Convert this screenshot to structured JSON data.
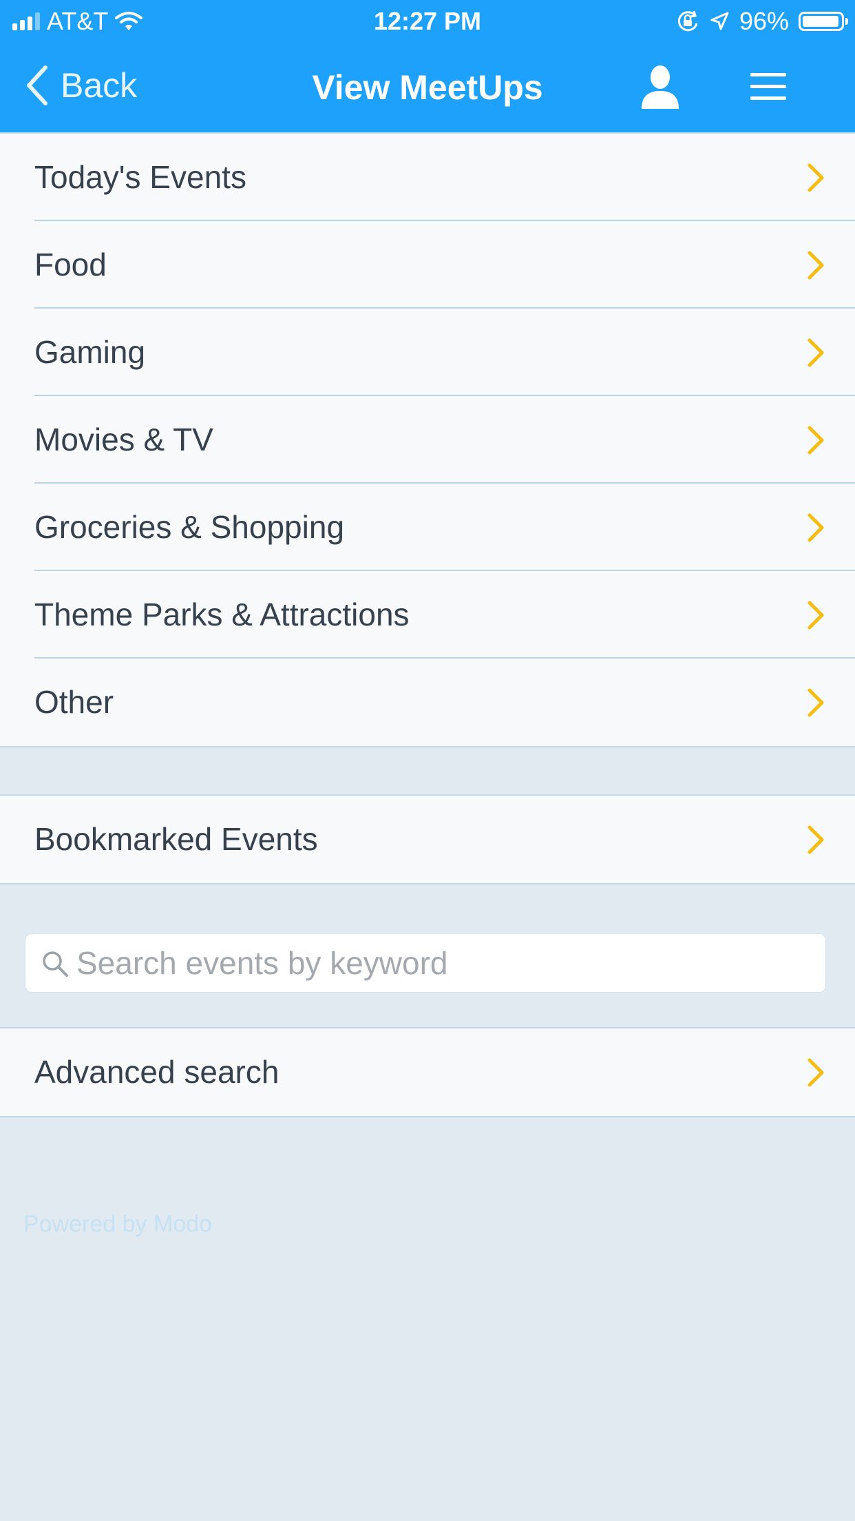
{
  "status_bar": {
    "carrier": "AT&T",
    "time": "12:27 PM",
    "battery_percent": "96%",
    "battery_level": 0.96,
    "icons": [
      "signal-icon",
      "wifi-icon",
      "orientation-lock-icon",
      "location-icon",
      "battery-icon"
    ]
  },
  "nav": {
    "back_label": "Back",
    "title": "View MeetUps",
    "profile_icon": "person-icon",
    "menu_icon": "hamburger-menu-icon"
  },
  "categories": [
    {
      "label": "Today's Events"
    },
    {
      "label": "Food"
    },
    {
      "label": "Gaming"
    },
    {
      "label": "Movies & TV"
    },
    {
      "label": "Groceries & Shopping"
    },
    {
      "label": "Theme Parks & Attractions"
    },
    {
      "label": "Other"
    }
  ],
  "bookmarks": {
    "label": "Bookmarked Events"
  },
  "search": {
    "placeholder": "Search events by keyword",
    "value": ""
  },
  "advanced_search": {
    "label": "Advanced search"
  },
  "footer": {
    "powered_by": "Powered by Modo"
  },
  "colors": {
    "header_bg": "#1ea1fb",
    "page_bg": "#e1eaf0",
    "row_bg": "#f7f9fb",
    "chevron": "#f5bd12",
    "row_text": "#36414d",
    "footer_text": "#c6e0f4"
  }
}
